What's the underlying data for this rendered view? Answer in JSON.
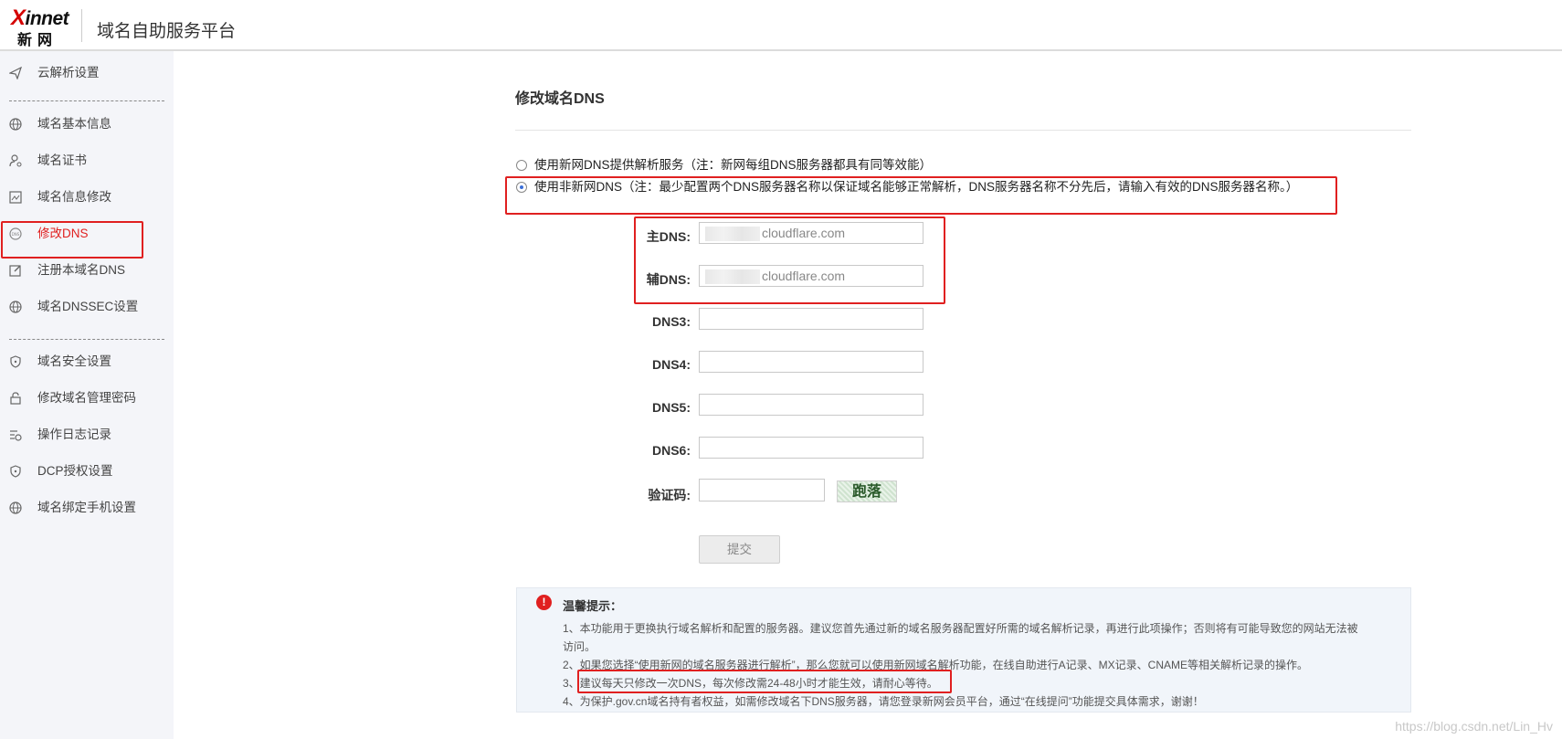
{
  "header": {
    "logo_top": "innet",
    "logo_x": "X",
    "logo_bottom": "新网",
    "title": "域名自助服务平台"
  },
  "sidebar": {
    "items": [
      {
        "label": "云解析设置",
        "icon": "send-icon"
      },
      {
        "label": "域名基本信息",
        "icon": "globe-icon"
      },
      {
        "label": "域名证书",
        "icon": "user-certificate-icon"
      },
      {
        "label": "域名信息修改",
        "icon": "image-edit-icon"
      },
      {
        "label": "修改DNS",
        "icon": "dns-icon",
        "active": true
      },
      {
        "label": "注册本域名DNS",
        "icon": "edit-icon"
      },
      {
        "label": "域名DNSSEC设置",
        "icon": "globe-icon"
      },
      {
        "label": "域名安全设置",
        "icon": "shield-icon"
      },
      {
        "label": "修改域名管理密码",
        "icon": "lock-icon"
      },
      {
        "label": "操作日志记录",
        "icon": "log-icon"
      },
      {
        "label": "DCP授权设置",
        "icon": "shield-icon"
      },
      {
        "label": "域名绑定手机设置",
        "icon": "globe-icon"
      }
    ]
  },
  "main": {
    "title": "修改域名DNS",
    "option1": "使用新网DNS提供解析服务（注：新网每组DNS服务器都具有同等效能）",
    "option2": "使用非新网DNS（注：最少配置两个DNS服务器名称以保证域名能够正常解析，DNS服务器名称不分先后，请输入有效的DNS服务器名称。）",
    "selected_option": 2,
    "fields": {
      "dns1_label": "主DNS:",
      "dns1_value": "cloudflare.com",
      "dns2_label": "辅DNS:",
      "dns2_value": "cloudflare.com",
      "dns3_label": "DNS3:",
      "dns4_label": "DNS4:",
      "dns5_label": "DNS5:",
      "dns6_label": "DNS6:",
      "captcha_label": "验证码:",
      "captcha_text": "跑落"
    },
    "submit_label": "提交"
  },
  "tips": {
    "icon": "!",
    "title": "温馨提示：",
    "lines": [
      "1、本功能用于更换执行域名解析和配置的服务器。建议您首先通过新的域名服务器配置好所需的域名解析记录，再进行此项操作；否则将有可能导致您的网站无法被",
      "访问。",
      "2、如果您选择“使用新网的域名服务器进行解析”，那么您就可以使用新网域名解析功能，在线自助进行A记录、MX记录、CNAME等相关解析记录的操作。",
      "3、建议每天只修改一次DNS，每次修改需24-48小时才能生效，请耐心等待。",
      "4、为保护.gov.cn域名持有者权益，如需修改域名下DNS服务器，请您登录新网会员平台，通过“在线提问”功能提交具体需求，谢谢！"
    ]
  },
  "watermark": "https://blog.csdn.net/Lin_Hv",
  "colors": {
    "highlight": "#e02020",
    "sidebar_bg": "#f4f5f9",
    "tips_bg": "#f1f5fa"
  }
}
